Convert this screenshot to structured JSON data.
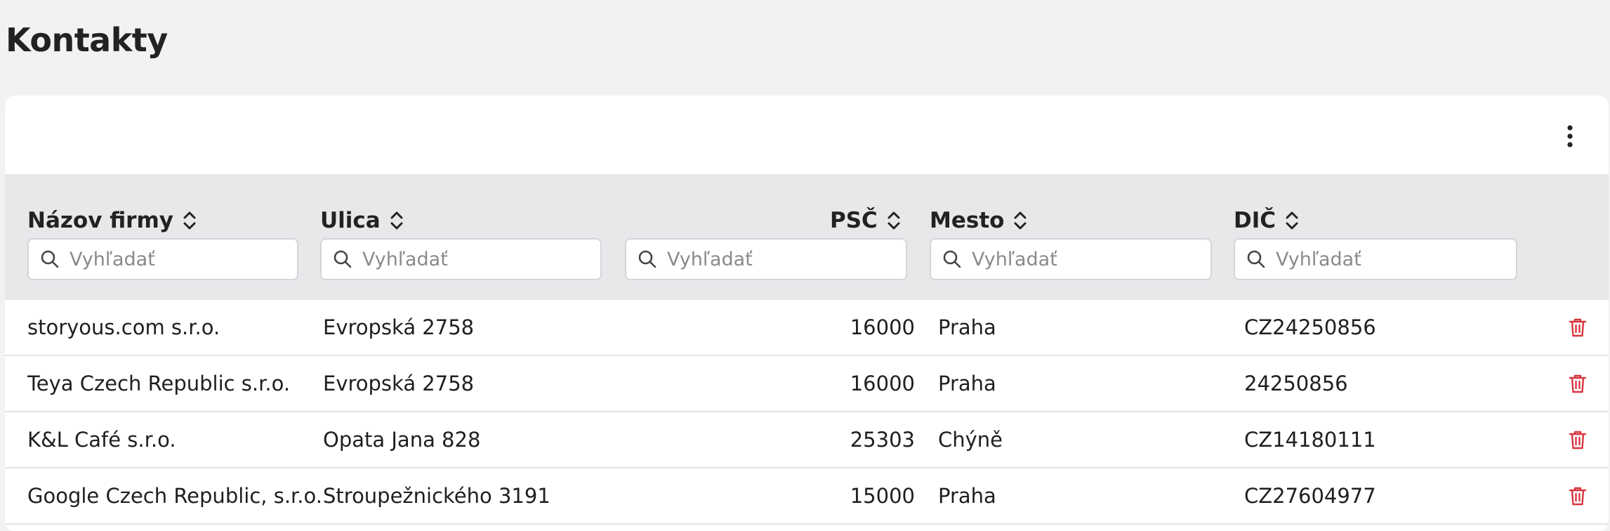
{
  "page": {
    "title": "Kontakty"
  },
  "table": {
    "columns": [
      {
        "key": "name",
        "label": "Názov firmy",
        "sortable": true
      },
      {
        "key": "street",
        "label": "Ulica",
        "sortable": true
      },
      {
        "key": "zip",
        "label": "PSČ",
        "sortable": true
      },
      {
        "key": "city",
        "label": "Mesto",
        "sortable": true
      },
      {
        "key": "vat",
        "label": "DIČ",
        "sortable": true
      }
    ],
    "search_placeholder": "Vyhľadať",
    "rows": [
      {
        "name": "storyous.com s.r.o.",
        "street": "Evropská 2758",
        "zip": "16000",
        "city": "Praha",
        "vat": "CZ24250856"
      },
      {
        "name": "Teya Czech Republic s.r.o.",
        "street": "Evropská 2758",
        "zip": "16000",
        "city": "Praha",
        "vat": "24250856"
      },
      {
        "name": "K&L Café s.r.o.",
        "street": "Opata Jana 828",
        "zip": "25303",
        "city": "Chýně",
        "vat": "CZ14180111"
      },
      {
        "name": "Google Czech Republic, s.r.o.",
        "street": "Stroupežnického 3191",
        "zip": "15000",
        "city": "Praha",
        "vat": "CZ27604977"
      }
    ]
  },
  "icons": {
    "more": "vertical-dots-icon",
    "sort": "chevron-up-down-icon",
    "search": "magnifier-icon",
    "delete": "trash-icon"
  },
  "colors": {
    "background": "#f2f2f2",
    "card": "#ffffff",
    "header": "#e7e8ea",
    "delete": "#d9363e"
  }
}
